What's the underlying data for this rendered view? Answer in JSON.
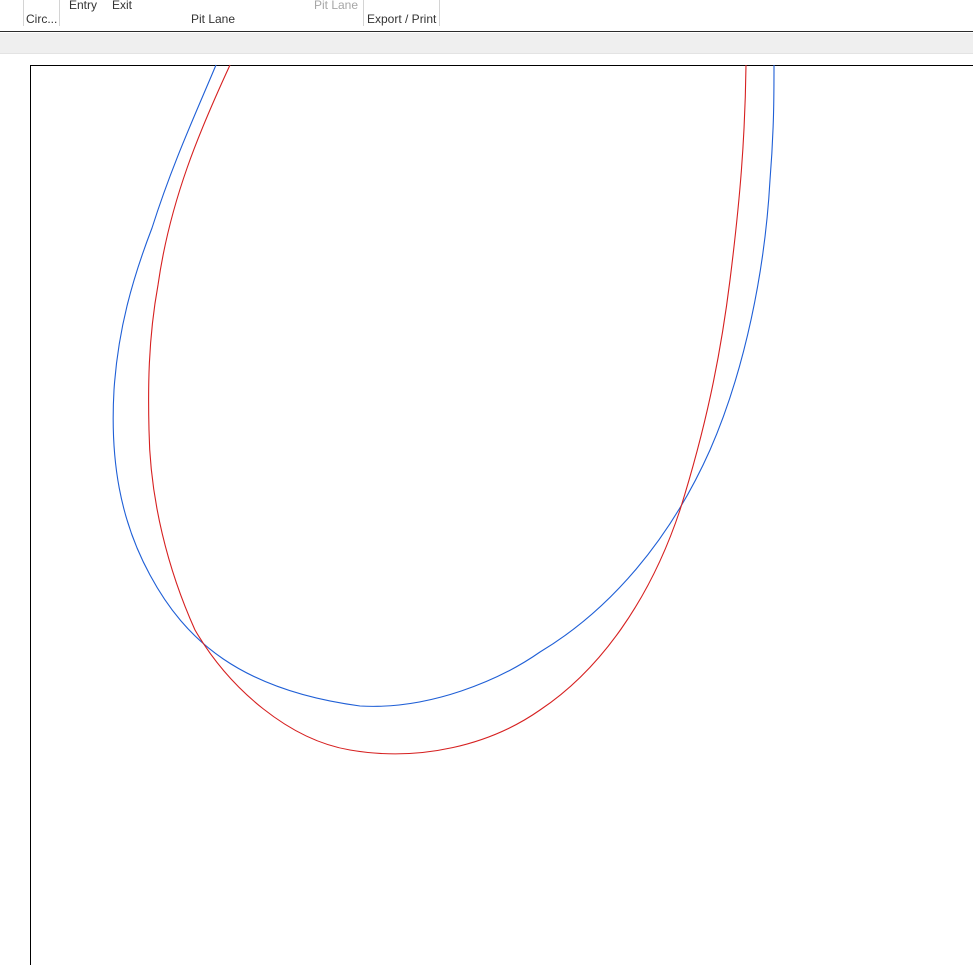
{
  "ribbon": {
    "group_circuit_label": "Circ...",
    "pit_lane_group": {
      "entry_label": "Entry",
      "exit_label": "Exit",
      "group_label": "Pit Lane",
      "disabled_pit_lane_label": "Pit Lane"
    },
    "export_group": {
      "group_label": "Export / Print"
    }
  },
  "track_view": {
    "lines": [
      {
        "color": "#1f5fd6"
      },
      {
        "color": "#d62020"
      }
    ]
  }
}
